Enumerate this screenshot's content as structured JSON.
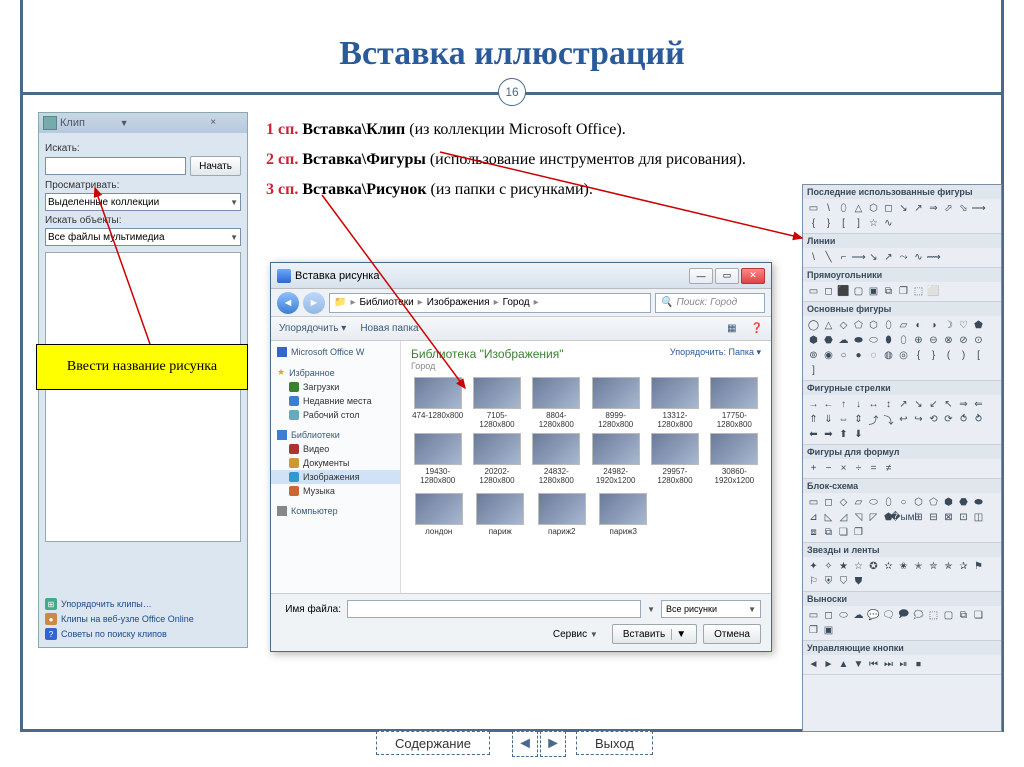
{
  "title": "Вставка иллюстраций",
  "page_num": "16",
  "text": {
    "p1_num": "1 сп.",
    "p1_bold": " Вставка\\Клип ",
    "p1_rest": "(из коллекции Microsoft Office).",
    "p2_num": "2 сп.",
    "p2_bold": " Вставка\\Фигуры ",
    "p2_rest": "(использование инструментов для рисования).",
    "p3_num": "3 сп.",
    "p3_bold": " Вставка\\Рисунок ",
    "p3_rest": "(из папки с рисунками)."
  },
  "callout": "Ввести название рисунка",
  "clip": {
    "title": "Клип",
    "f_search": "Искать:",
    "btn_search": "Начать",
    "f_where": "Просматривать:",
    "where_val": "Выделенные коллекции",
    "f_objects": "Искать объекты:",
    "objects_val": "Все файлы мультимедиа",
    "link1": "Упорядочить клипы…",
    "link2": "Клипы на веб-узле Office Online",
    "link3": "Советы по поиску клипов"
  },
  "filedlg": {
    "title": "Вставка рисунка",
    "crumb1": "Библиотеки",
    "crumb2": "Изображения",
    "crumb3": "Город",
    "search_ph": "Поиск: Город",
    "tb1": "Упорядочить ▾",
    "tb2": "Новая папка",
    "side_hdr1": "Microsoft Office W",
    "side_fav": "Избранное",
    "side_dl": "Загрузки",
    "side_recent": "Недавние места",
    "side_desktop": "Рабочий стол",
    "side_lib": "Библиотеки",
    "side_video": "Видео",
    "side_docs": "Документы",
    "side_img": "Изображения",
    "side_music": "Музыка",
    "side_comp": "Компьютер",
    "lib_title": "Библиотека \"Изображения\"",
    "lib_sub": "Город",
    "sort": "Упорядочить:  Папка ▾",
    "thumbs": [
      "474-1280x800",
      "7105-1280x800",
      "8804-1280x800",
      "8999-1280x800",
      "13312-1280x800",
      "17750-1280x800",
      "19430-1280x800",
      "20202-1280x800",
      "24832-1280x800",
      "24982-1920x1200",
      "29957-1280x800",
      "30860-1920x1200"
    ],
    "thumbs2": [
      "лондон",
      "париж",
      "париж2",
      "париж3"
    ],
    "lbl_filename": "Имя файла:",
    "filter": "Все рисунки",
    "lbl_service": "Сервис",
    "btn_insert": "Вставить",
    "btn_cancel": "Отмена"
  },
  "shapes": {
    "g1": "Последние использованные фигуры",
    "g2": "Линии",
    "g3": "Прямоугольники",
    "g4": "Основные фигуры",
    "g5": "Фигурные стрелки",
    "g6": "Фигуры для формул",
    "g7": "Блок-схема",
    "g8": "Звезды и ленты",
    "g9": "Выноски",
    "g10": "Управляющие кнопки"
  },
  "nav": {
    "contents": "Содержание",
    "exit": "Выход"
  }
}
